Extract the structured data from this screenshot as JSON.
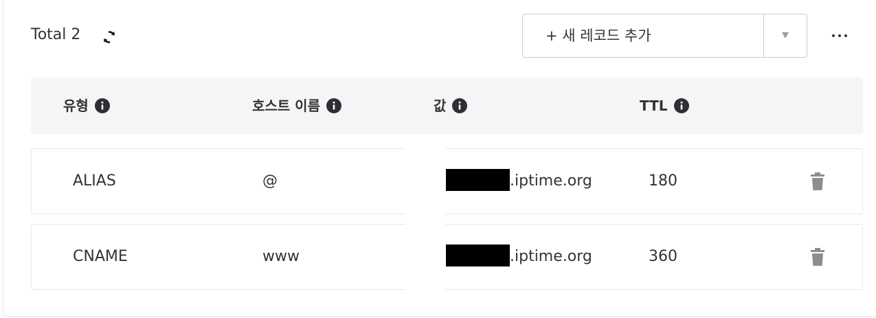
{
  "toolbar": {
    "total_label": "Total 2",
    "add_record_label": "+ 새 레코드 추가"
  },
  "table": {
    "headers": [
      {
        "label": "유형"
      },
      {
        "label": "호스트 이름"
      },
      {
        "label": "값"
      },
      {
        "label": "TTL"
      }
    ],
    "rows": [
      {
        "type": "ALIAS",
        "host": "@",
        "value_suffix": ".iptime.org",
        "ttl": "180"
      },
      {
        "type": "CNAME",
        "host": "www",
        "value_suffix": ".iptime.org",
        "ttl": "360"
      }
    ]
  },
  "colors": {
    "header_bg": "#f4f5f7",
    "icon_dark": "#2d2f33",
    "trash_gray": "#8a8d92",
    "border": "#e6e8eb"
  },
  "icons": [
    "refresh-icon",
    "chevron-down-icon",
    "more-icon",
    "info-icon",
    "trash-icon"
  ]
}
